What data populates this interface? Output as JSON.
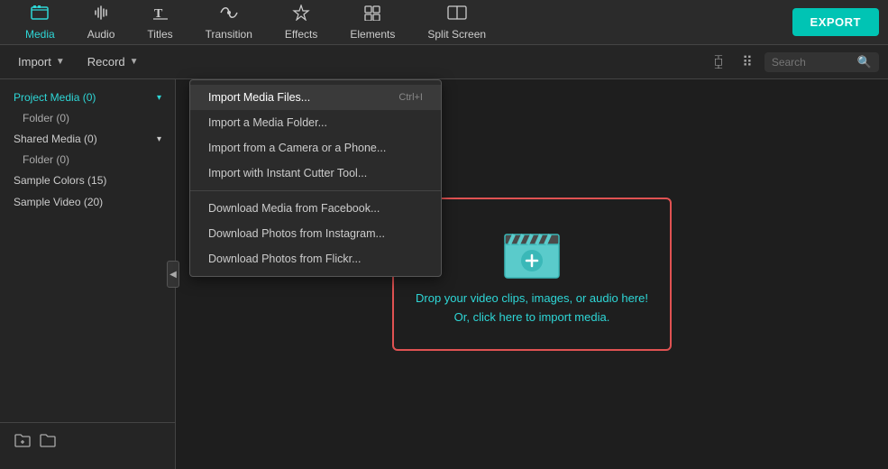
{
  "toolbar": {
    "export_label": "EXPORT",
    "items": [
      {
        "id": "media",
        "label": "Media",
        "icon": "📁",
        "active": true
      },
      {
        "id": "audio",
        "label": "Audio",
        "icon": "♪"
      },
      {
        "id": "titles",
        "label": "Titles",
        "icon": "T"
      },
      {
        "id": "transition",
        "label": "Transition",
        "icon": "◎"
      },
      {
        "id": "effects",
        "label": "Effects",
        "icon": "✦"
      },
      {
        "id": "elements",
        "label": "Elements",
        "icon": "⊞"
      },
      {
        "id": "split-screen",
        "label": "Split Screen",
        "icon": "⧉"
      }
    ]
  },
  "sub_toolbar": {
    "import_label": "Import",
    "record_label": "Record",
    "search_placeholder": "Search"
  },
  "sidebar": {
    "items": [
      {
        "id": "project-media",
        "label": "Project Media (0)",
        "has_chevron": true,
        "active": true
      },
      {
        "id": "folder",
        "label": "Folder (0)",
        "sub": true
      },
      {
        "id": "shared-media",
        "label": "Shared Media (0)",
        "has_chevron": true
      },
      {
        "id": "shared-folder",
        "label": "Folder (0)",
        "sub": true
      },
      {
        "id": "sample-colors",
        "label": "Sample Colors (15)"
      },
      {
        "id": "sample-video",
        "label": "Sample Video (20)"
      }
    ],
    "footer": {
      "add_folder_icon": "+📁",
      "folder_icon": "📁"
    }
  },
  "dropdown": {
    "items": [
      {
        "id": "import-media-files",
        "label": "Import Media Files...",
        "shortcut": "Ctrl+I",
        "active": true
      },
      {
        "id": "import-media-folder",
        "label": "Import a Media Folder...",
        "shortcut": ""
      },
      {
        "id": "import-camera",
        "label": "Import from a Camera or a Phone...",
        "shortcut": ""
      },
      {
        "id": "import-cutter",
        "label": "Import with Instant Cutter Tool...",
        "shortcut": ""
      },
      {
        "id": "divider1",
        "divider": true
      },
      {
        "id": "download-facebook",
        "label": "Download Media from Facebook...",
        "shortcut": ""
      },
      {
        "id": "download-instagram",
        "label": "Download Photos from Instagram...",
        "shortcut": ""
      },
      {
        "id": "download-flickr",
        "label": "Download Photos from Flickr...",
        "shortcut": ""
      }
    ]
  },
  "drop_zone": {
    "text_line1": "Drop your video clips, images, or audio here!",
    "text_line2": "Or, click here to import media."
  },
  "colors": {
    "accent": "#2ed7d7",
    "export_bg": "#00c4b4",
    "drop_border": "#e05252"
  }
}
